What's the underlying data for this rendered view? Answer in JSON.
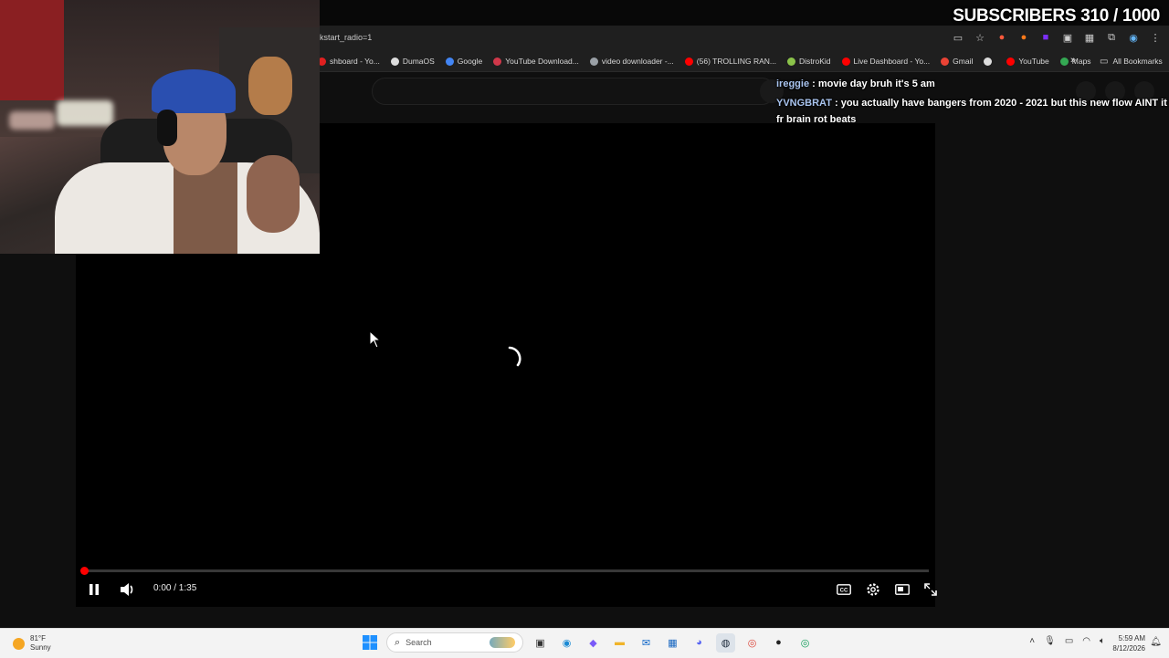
{
  "browser": {
    "url": "kstart_radio=1",
    "bookmarks": [
      {
        "label": "shboard - Yo...",
        "color": "#e02020"
      },
      {
        "label": "DumaOS",
        "color": "#dddddd"
      },
      {
        "label": "Google",
        "color": "#4285f4"
      },
      {
        "label": "YouTube Download...",
        "color": "#d0384a"
      },
      {
        "label": "video downloader -...",
        "color": "#9aa0a6"
      },
      {
        "label": "(56) TROLLING RAN...",
        "color": "#ff0000"
      },
      {
        "label": "DistroKid",
        "color": "#8bc34a"
      },
      {
        "label": "Live Dashboard - Yo...",
        "color": "#ff0000"
      },
      {
        "label": "Gmail",
        "color": "#ea4335"
      },
      {
        "label": "",
        "color": "#dddddd"
      },
      {
        "label": "YouTube",
        "color": "#ff0000"
      },
      {
        "label": "Maps",
        "color": "#34a853"
      }
    ],
    "all_bookmarks": "All Bookmarks",
    "more_icon": "»"
  },
  "player": {
    "time": "0:00 / 1:35",
    "progress_fraction": 0.002,
    "state": "buffering"
  },
  "overlay": {
    "subscribers": "SUBSCRIBERS 310 / 1000",
    "chat": [
      {
        "user": "ireggie",
        "message": " : movie day bruh it's 5 am"
      },
      {
        "user": "YVNGBRAT",
        "message": " : you actually have bangers from 2020 - 2021 but this new flow AINT it fr brain rot beats"
      }
    ]
  },
  "taskbar": {
    "weather_temp": "81°F",
    "weather_cond": "Sunny",
    "search_placeholder": "Search",
    "time": "5:59 AM",
    "date": "8/12/2026"
  },
  "colors": {
    "accent_red": "#ff0000",
    "chat_username": "#a9c4ef"
  }
}
